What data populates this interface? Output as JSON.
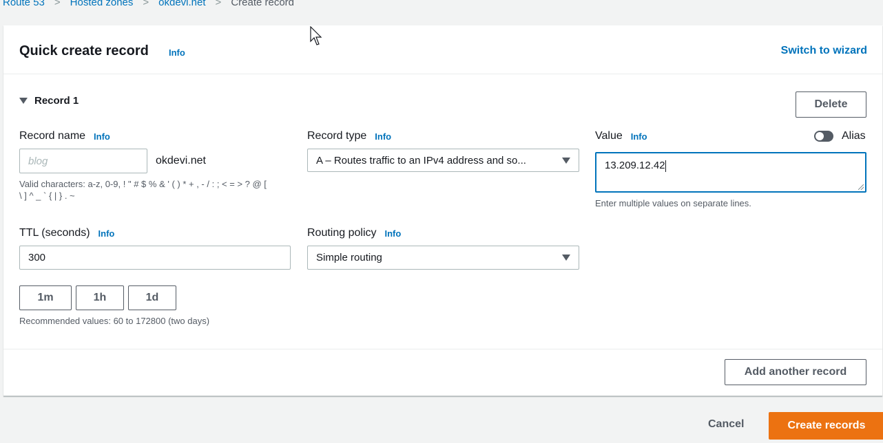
{
  "breadcrumb": {
    "items": [
      "Route 53",
      "Hosted zones",
      "okdevi.net"
    ],
    "current": "Create record"
  },
  "header": {
    "title": "Quick create record",
    "info": "Info",
    "switch_wizard": "Switch to wizard"
  },
  "record": {
    "label": "Record 1",
    "delete": "Delete",
    "record_name": {
      "label": "Record name",
      "info": "Info",
      "placeholder": "blog",
      "suffix": "okdevi.net",
      "hint_line1": "Valid characters: a-z, 0-9, ! \" # $ % & ' ( ) * + , - / : ; < = > ? @ [",
      "hint_line2": "\\ ] ^ _ ` { | } . ~"
    },
    "record_type": {
      "label": "Record type",
      "info": "Info",
      "value": "A – Routes traffic to an IPv4 address and so..."
    },
    "value": {
      "label": "Value",
      "info": "Info",
      "text": "13.209.12.42",
      "hint": "Enter multiple values on separate lines."
    },
    "alias": {
      "label": "Alias",
      "enabled": false
    },
    "ttl": {
      "label": "TTL (seconds)",
      "info": "Info",
      "value": "300",
      "presets": [
        "1m",
        "1h",
        "1d"
      ],
      "hint": "Recommended values: 60 to 172800 (two days)"
    },
    "routing_policy": {
      "label": "Routing policy",
      "info": "Info",
      "value": "Simple routing"
    }
  },
  "actions": {
    "add_another": "Add another record",
    "cancel": "Cancel",
    "create": "Create records"
  },
  "colors": {
    "link": "#0073bb",
    "primary_button": "#ec7211",
    "focus_border": "#0073bb",
    "background": "#f2f3f3"
  },
  "icons": {
    "caret": "caret-down-icon",
    "dropdown": "triangle-down-icon",
    "pointer": "mouse-pointer-icon"
  }
}
